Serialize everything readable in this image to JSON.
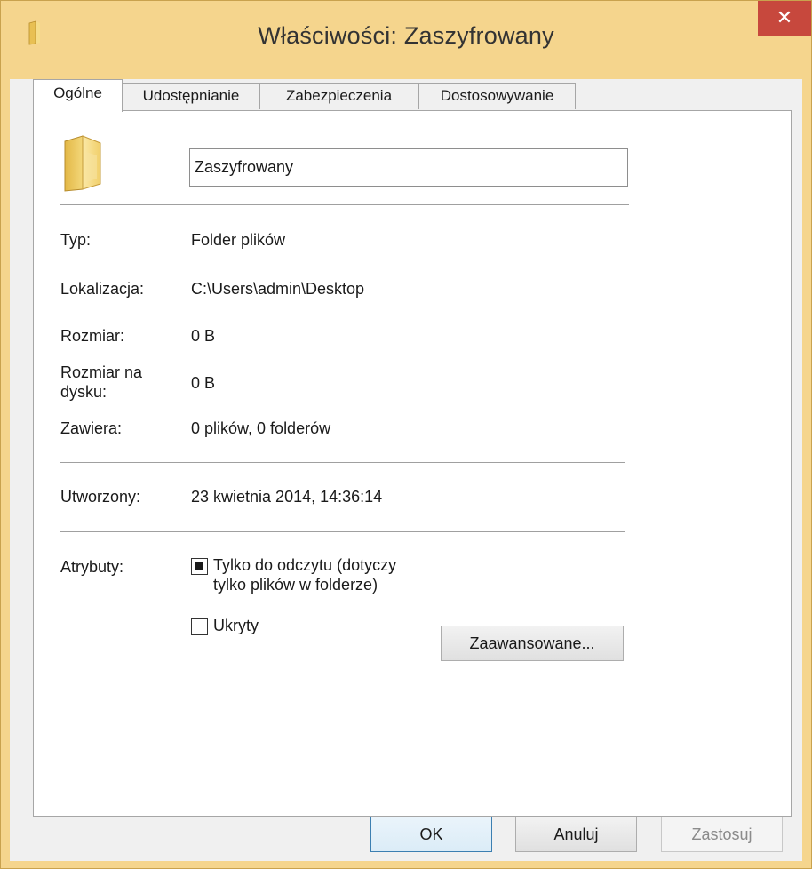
{
  "window": {
    "title": "Właściwości: Zaszyfrowany",
    "close_glyph": "✕"
  },
  "tabs": [
    {
      "label": "Ogólne",
      "active": true
    },
    {
      "label": "Udostępnianie",
      "active": false
    },
    {
      "label": "Zabezpieczenia",
      "active": false
    },
    {
      "label": "Dostosowywanie",
      "active": false
    }
  ],
  "general": {
    "name_value": "Zaszyfrowany",
    "type_label": "Typ:",
    "type_value": "Folder plików",
    "location_label": "Lokalizacja:",
    "location_value": "C:\\Users\\admin\\Desktop",
    "size_label": "Rozmiar:",
    "size_value": "0 B",
    "size_on_disk_label_line1": "Rozmiar na",
    "size_on_disk_label_line2": "dysku:",
    "size_on_disk_value": "0 B",
    "contains_label": "Zawiera:",
    "contains_value": "0 plików, 0 folderów",
    "created_label": "Utworzony:",
    "created_value": "23 kwietnia 2014, 14:36:14",
    "attributes_label": "Atrybuty:",
    "readonly_label_line1": "Tylko do odczytu (dotyczy",
    "readonly_label_line2": "tylko plików w folderze)",
    "readonly_state": "indeterminate",
    "hidden_label": "Ukryty",
    "hidden_state": "unchecked",
    "advanced_button": "Zaawansowane..."
  },
  "buttons": {
    "ok": "OK",
    "cancel": "Anuluj",
    "apply": "Zastosuj"
  },
  "icons": {
    "title_icon": "folder-icon",
    "large_icon": "folder-icon"
  },
  "colors": {
    "frame": "#f5d58d",
    "close": "#c7483d",
    "default_button_border": "#3c7fb1"
  }
}
